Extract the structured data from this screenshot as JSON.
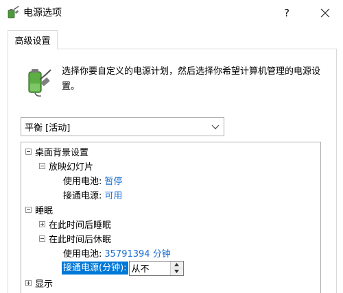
{
  "window": {
    "title": "电源选项",
    "help_label": "?",
    "icon": "power-options-icon",
    "close_icon": "close-icon"
  },
  "tab": {
    "label": "高级设置"
  },
  "description": {
    "text": "选择你要自定义的电源计划，然后选择你希望计算机管理的电源设置。",
    "icon": "battery-plug-icon"
  },
  "plan": {
    "selected": "平衡 [活动]"
  },
  "tree": {
    "desktop_background": "桌面背景设置",
    "slideshow": "放映幻灯片",
    "slideshow_battery_label": "使用电池:",
    "slideshow_battery_value": "暂停",
    "slideshow_plugged_label": "接通电源:",
    "slideshow_plugged_value": "可用",
    "sleep": "睡眠",
    "sleep_after": "在此时间后睡眠",
    "hibernate_after": "在此时间后休眠",
    "hibernate_battery_label": "使用电池:",
    "hibernate_battery_value": "35791394 分钟",
    "hibernate_plugged_label": "接通电源(分钟):",
    "hibernate_plugged_value": "从不",
    "display": "显示"
  },
  "colors": {
    "link_value": "#1a6fd1",
    "selection": "#0078d7"
  }
}
